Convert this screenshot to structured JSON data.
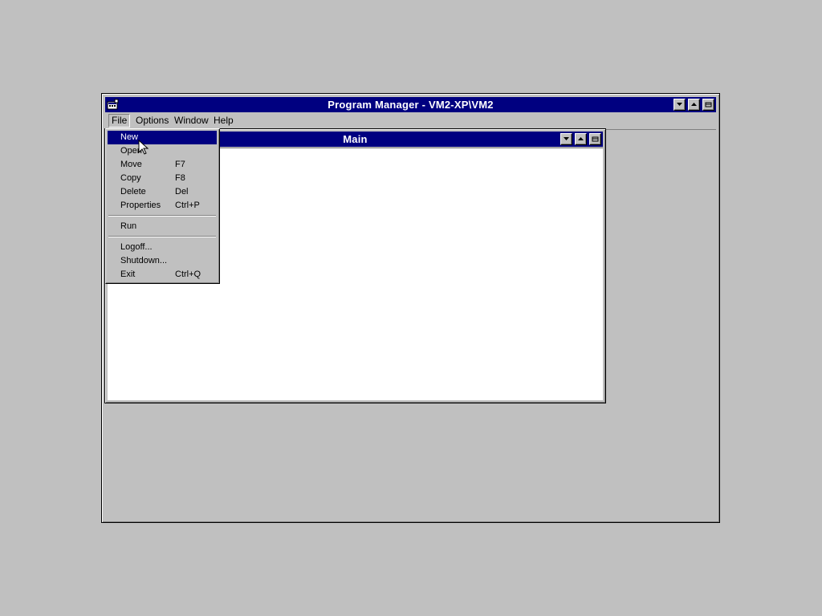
{
  "program_manager": {
    "title": "Program Manager - VM2-XP\\VM2",
    "menu": [
      "File",
      "Options",
      "Window",
      "Help"
    ]
  },
  "main_window": {
    "title": "Main"
  },
  "file_menu": {
    "items": [
      {
        "label": "New",
        "shortcut": ""
      },
      {
        "label": "Open",
        "shortcut": ""
      },
      {
        "label": "Move",
        "shortcut": "F7"
      },
      {
        "label": "Copy",
        "shortcut": "F8"
      },
      {
        "label": "Delete",
        "shortcut": "Del"
      },
      {
        "label": "Properties",
        "shortcut": "Ctrl+P"
      },
      {
        "label": "Run",
        "shortcut": ""
      },
      {
        "label": "Logoff...",
        "shortcut": ""
      },
      {
        "label": "Shutdown...",
        "shortcut": ""
      },
      {
        "label": "Exit",
        "shortcut": "Ctrl+Q"
      }
    ],
    "highlighted": "New"
  },
  "icons": {
    "system_menu": "program-manager-icon",
    "minimize": "minimize-arrow-icon",
    "maximize": "maximize-arrow-icon",
    "restore": "restore-icon",
    "cursor": "mouse-pointer-icon"
  },
  "colors": {
    "desktop": "#c0c0c0",
    "titlebar_active": "#000080",
    "menu_highlight": "#000080",
    "client": "#ffffff"
  }
}
